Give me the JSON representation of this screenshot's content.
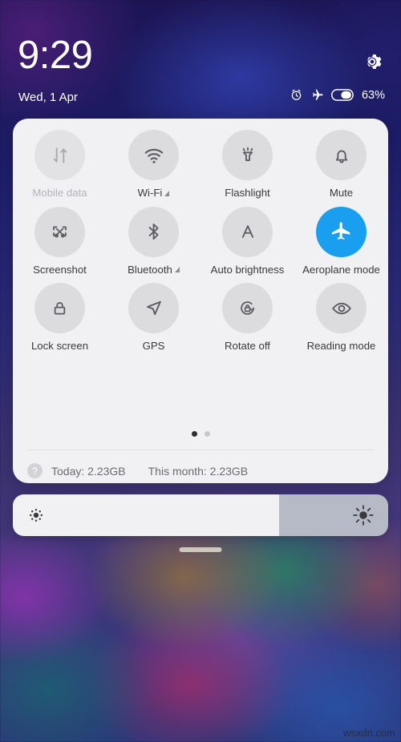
{
  "status_bar": {
    "time": "9:29",
    "date": "Wed, 1 Apr",
    "battery_percent": "63%",
    "gear_icon": "gear-icon",
    "alarm_icon": "alarm-icon",
    "airplane_icon": "airplane-icon",
    "battery_icon": "battery-icon",
    "battery_level": 63
  },
  "quick_settings": {
    "tiles": [
      {
        "label": "Mobile data",
        "icon": "mobile-data-icon",
        "state": "disabled",
        "caret": false
      },
      {
        "label": "Wi-Fi",
        "icon": "wifi-icon",
        "state": "off",
        "caret": true
      },
      {
        "label": "Flashlight",
        "icon": "flashlight-icon",
        "state": "off",
        "caret": false
      },
      {
        "label": "Mute",
        "icon": "bell-icon",
        "state": "off",
        "caret": false
      },
      {
        "label": "Screenshot",
        "icon": "screenshot-icon",
        "state": "off",
        "caret": false
      },
      {
        "label": "Bluetooth",
        "icon": "bluetooth-icon",
        "state": "off",
        "caret": true
      },
      {
        "label": "Auto brightness",
        "icon": "auto-brightness-icon",
        "state": "off",
        "caret": false
      },
      {
        "label": "Aeroplane mode",
        "icon": "airplane-icon",
        "state": "active",
        "caret": false
      },
      {
        "label": "Lock screen",
        "icon": "lock-icon",
        "state": "off",
        "caret": false
      },
      {
        "label": "GPS",
        "icon": "gps-icon",
        "state": "off",
        "caret": false
      },
      {
        "label": "Rotate off",
        "icon": "rotate-lock-icon",
        "state": "off",
        "caret": false
      },
      {
        "label": "Reading mode",
        "icon": "eye-icon",
        "state": "off",
        "caret": false
      }
    ],
    "pager": {
      "pages": 2,
      "active_page": 1
    },
    "data_usage": {
      "help_icon_label": "?",
      "today": "Today: 2.23GB",
      "this_month": "This month: 2.23GB"
    }
  },
  "brightness": {
    "level_percent": 71,
    "low_icon": "brightness-low-icon",
    "high_icon": "brightness-high-icon"
  },
  "home_indicator": "home-indicator",
  "watermark": "wsxdn.com",
  "colors": {
    "accent_active": "#1a9ff0",
    "panel_bg": "#f1f1f4",
    "tile_circle": "#dcdcdf",
    "label_text": "#3a3a3c",
    "disabled_text": "#b4b4b8"
  }
}
